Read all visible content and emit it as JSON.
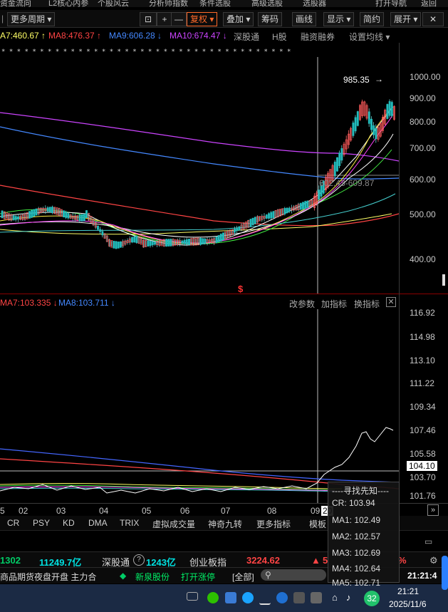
{
  "top_menu": [
    "资金流向",
    "L2核心内参",
    "个股风云",
    "分析师指数",
    "条件选股",
    "高级选股",
    "选股器",
    "打开导航",
    "返回"
  ],
  "toolbar": {
    "period": "更多周期",
    "lock_icon": "lock-icon",
    "plus": "+",
    "minus": "—",
    "fuquan": "复权",
    "diejia": "叠加",
    "chouma": "筹码",
    "huaxian": "画线",
    "xianshi": "显示",
    "jianyue": "简约",
    "zhankai": "展开",
    "close": "✕"
  },
  "ma_legend": [
    {
      "text": "A7:460.67 ↑",
      "color": "#ffff66"
    },
    {
      "text": "MA8:476.37 ↑",
      "color": "#ff4444"
    },
    {
      "text": "MA9:606.28 ↓",
      "color": "#4488ff"
    },
    {
      "text": "MA10:674.47 ↓",
      "color": "#cc44ff"
    },
    {
      "text": "深股通",
      "color": "#aaaaaa"
    },
    {
      "text": "H股",
      "color": "#aaaaaa"
    },
    {
      "text": "融资融券",
      "color": "#aaaaaa"
    },
    {
      "text": "设置均线",
      "color": "#aaaaaa"
    }
  ],
  "main_chart": {
    "y_labels": [
      "1000.00",
      "900.00",
      "800.00",
      "700.00",
      "600.00",
      "500.00",
      "400.00"
    ],
    "high_label": "985.35",
    "range_label": "602.43-609.87",
    "marker": "$"
  },
  "sub_legend": [
    {
      "text": "MA7:103.335 ↓",
      "color": "#ff4444"
    },
    {
      "text": "MA8:103.711 ↓",
      "color": "#4488ff"
    }
  ],
  "sub_tools": [
    "改参数",
    "加指标",
    "换指标"
  ],
  "sub_chart": {
    "y_labels": [
      "116.92",
      "114.98",
      "113.10",
      "111.22",
      "109.34",
      "107.46",
      "105.58",
      "104.10",
      "103.70",
      "101.76"
    ]
  },
  "x_labels": [
    "5",
    "02",
    "03",
    "04",
    "05",
    "06",
    "07",
    "08",
    "09",
    "20"
  ],
  "indicator_tabs": [
    "CR",
    "PSY",
    "KD",
    "DMA",
    "TRIX",
    "虚拟成交量",
    "神奇九转",
    "更多指标",
    "模板"
  ],
  "tooltip": {
    "title": "----寻找先知----",
    "rows": [
      "CR: 103.94",
      "MA1: 102.49",
      "MA2: 102.57",
      "MA3: 102.69",
      "MA4: 102.64",
      "MA5: 102.71"
    ]
  },
  "ticker": {
    "v1": "1302",
    "v2": "11249.7亿",
    "label3": "深股通",
    "v3": "1243亿",
    "label4": "创业板指",
    "v4": "3224.62",
    "v5": "5",
    "v6": "%"
  },
  "statusbar": {
    "left": "商品期货夜盘开盘 主力合",
    "stock": "新泉股份",
    "action": "打开涨停",
    "all": "[全部]",
    "time": "21:21:4"
  },
  "taskbar": {
    "badge": "32",
    "time": "21:21",
    "date": "2025/11/6"
  },
  "colors": {
    "up": "#ff3333",
    "down": "#00cc66",
    "accent": "#ff6a2a"
  }
}
